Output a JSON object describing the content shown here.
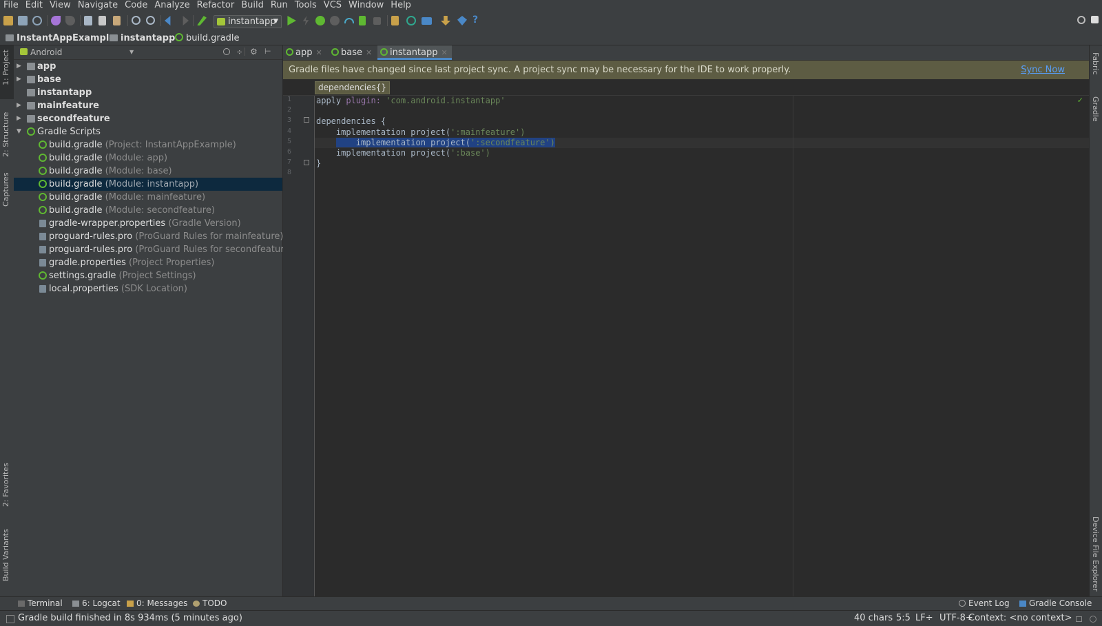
{
  "menu": [
    "File",
    "Edit",
    "View",
    "Navigate",
    "Code",
    "Analyze",
    "Refactor",
    "Build",
    "Run",
    "Tools",
    "VCS",
    "Window",
    "Help"
  ],
  "toolbar": {
    "run_config": "instantapp",
    "icons": [
      "open-icon",
      "save-icon",
      "sync-icon",
      "undo-icon",
      "redo-icon",
      "cut-icon",
      "copy-icon",
      "paste-icon",
      "find-icon",
      "replace-icon",
      "back-icon",
      "forward-icon",
      "make-project-icon",
      "run-icon",
      "apply-changes-icon",
      "debug-icon",
      "attach-debugger-icon",
      "profile-icon",
      "coverage-icon",
      "stop-icon",
      "avd-manager-icon",
      "gradle-sync-icon",
      "project-structure-icon",
      "sdk-manager-icon",
      "android-device-monitor-icon",
      "help-icon",
      "search-everywhere-icon",
      "maximize-icon"
    ]
  },
  "breadcrumbs": [
    "InstantAppExample",
    "instantapp",
    "build.gradle"
  ],
  "left_strip": [
    "1: Project",
    "2: Structure",
    "Captures",
    "2: Favorites",
    "Build Variants"
  ],
  "right_strip": [
    "Fabric",
    "Gradle",
    "Device File Explorer"
  ],
  "project_panel": {
    "view": "Android",
    "tree": [
      {
        "name": "app",
        "hint": ""
      },
      {
        "name": "base",
        "hint": ""
      },
      {
        "name": "instantapp",
        "hint": ""
      },
      {
        "name": "mainfeature",
        "hint": ""
      },
      {
        "name": "secondfeature",
        "hint": ""
      },
      {
        "name": "Gradle Scripts",
        "hint": ""
      },
      {
        "name": "build.gradle",
        "hint": "(Project: InstantAppExample)"
      },
      {
        "name": "build.gradle",
        "hint": "(Module: app)"
      },
      {
        "name": "build.gradle",
        "hint": "(Module: base)"
      },
      {
        "name": "build.gradle",
        "hint": "(Module: instantapp)"
      },
      {
        "name": "build.gradle",
        "hint": "(Module: mainfeature)"
      },
      {
        "name": "build.gradle",
        "hint": "(Module: secondfeature)"
      },
      {
        "name": "gradle-wrapper.properties",
        "hint": "(Gradle Version)"
      },
      {
        "name": "proguard-rules.pro",
        "hint": "(ProGuard Rules for mainfeature)"
      },
      {
        "name": "proguard-rules.pro",
        "hint": "(ProGuard Rules for secondfeature)"
      },
      {
        "name": "gradle.properties",
        "hint": "(Project Properties)"
      },
      {
        "name": "settings.gradle",
        "hint": "(Project Settings)"
      },
      {
        "name": "local.properties",
        "hint": "(SDK Location)"
      }
    ],
    "selected_index": 9
  },
  "editor": {
    "tabs": [
      "app",
      "base",
      "instantapp"
    ],
    "active_tab": "instantapp",
    "banner": "Gradle files have changed since last project sync. A project sync may be necessary for the IDE to work properly.",
    "sync_now": "Sync Now",
    "scope": "dependencies{}",
    "line_numbers": [
      "1",
      "2",
      "3",
      "4",
      "5",
      "6",
      "7",
      "8"
    ],
    "lines": [
      [
        "apply ",
        "plugin: ",
        "'com.android.instantapp'"
      ],
      [
        "",
        "",
        ""
      ],
      [
        "dependencies {",
        "",
        ""
      ],
      [
        "    implementation project(",
        "'",
        ":mainfeature')"
      ],
      [
        "    implementation project(",
        "'",
        ":secondfeature')"
      ],
      [
        "    implementation project(",
        "'",
        ":base')"
      ],
      [
        "}",
        "",
        ""
      ],
      [
        "",
        "",
        ""
      ]
    ]
  },
  "bottom_tools": {
    "terminal": "Terminal",
    "logcat": "6: Logcat",
    "messages": "0: Messages",
    "todo": "TODO",
    "event_log": "Event Log",
    "gradle_console": "Gradle Console"
  },
  "status": {
    "message": "Gradle build finished in 8s 934ms (5 minutes ago)",
    "chars": "40 chars",
    "position": "5:5",
    "line_sep": "LF÷",
    "encoding": "UTF-8÷",
    "context": "Context: <no context>"
  }
}
